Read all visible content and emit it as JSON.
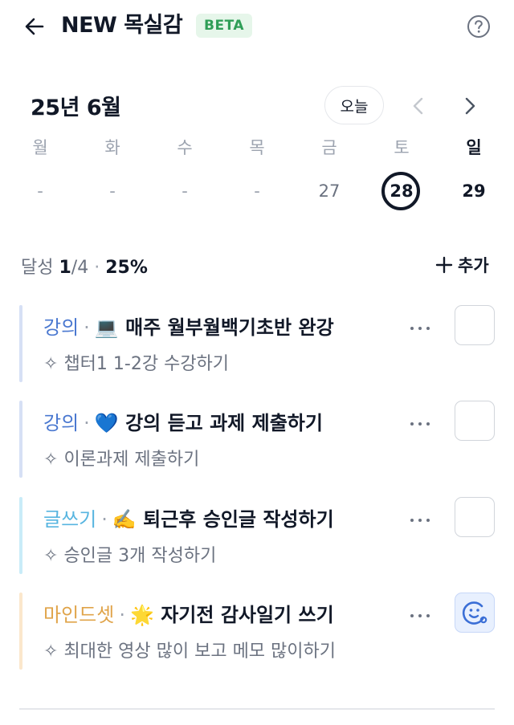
{
  "header": {
    "title": "NEW 목실감",
    "badge": "BETA"
  },
  "calendar": {
    "month_label": "25년 6월",
    "today_button": "오늘",
    "weekdays": [
      "월",
      "화",
      "수",
      "목",
      "금",
      "토",
      "일"
    ],
    "dates": [
      "-",
      "-",
      "-",
      "-",
      "27",
      "28",
      "29"
    ],
    "selected_date": "28"
  },
  "progress": {
    "label": "달성",
    "done": "1",
    "total": "/4",
    "separator": "·",
    "percent": "25%"
  },
  "add_button": {
    "label": "추가"
  },
  "tasks": [
    {
      "category": "강의",
      "category_color": "#4a78d0",
      "bar_color": "#d6e0f5",
      "emoji": "💻",
      "title": "매주 월부월백기초반 완강",
      "sub_icon": "✧",
      "subtitle": "챕터1 1-2강 수강하기",
      "done": false
    },
    {
      "category": "강의",
      "category_color": "#4a78d0",
      "bar_color": "#d6e0f5",
      "emoji": "💙",
      "title": "강의 듣고 과제 제출하기",
      "sub_icon": "✧",
      "subtitle": "이론과제 제출하기",
      "done": false
    },
    {
      "category": "글쓰기",
      "category_color": "#57b5e0",
      "bar_color": "#c9ecf8",
      "emoji": "✍️",
      "title": "퇴근후 승인글 작성하기",
      "sub_icon": "✧",
      "subtitle": "승인글 3개 작성하기",
      "done": false
    },
    {
      "category": "마인드셋",
      "category_color": "#e0a44a",
      "bar_color": "#fbe7cc",
      "emoji": "🌟",
      "title": "자기전 감사일기 쓰기",
      "sub_icon": "✧",
      "subtitle": "최대한 영상 많이 보고 메모 많이하기",
      "done": true
    }
  ],
  "icons": {
    "back": "arrow-left-icon",
    "help": "question-circle-icon",
    "prev": "chevron-left-icon",
    "next": "chevron-right-icon",
    "more": "more-horizontal-icon",
    "done": "smiley-face-icon"
  }
}
